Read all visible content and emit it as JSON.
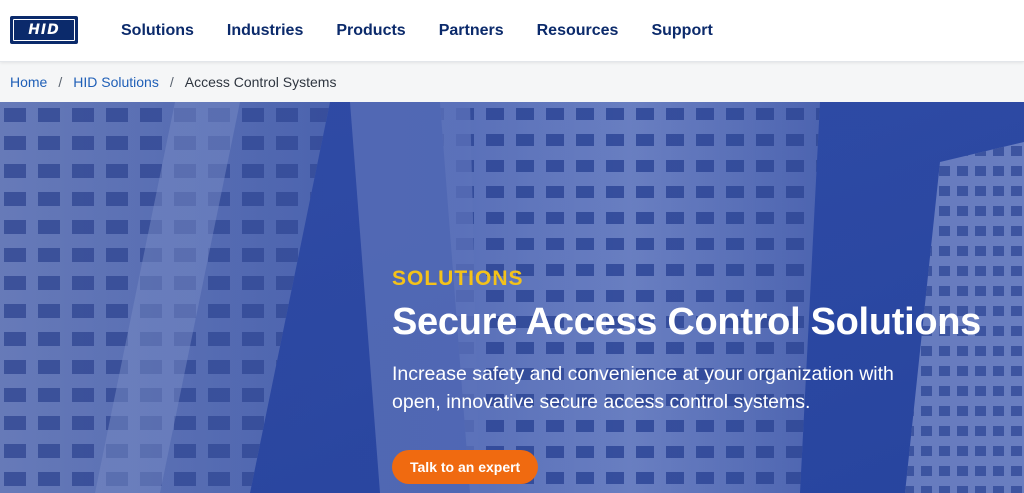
{
  "brand": {
    "logo_text": "HID",
    "color": "#0b2a6b"
  },
  "nav": {
    "items": [
      {
        "label": "Solutions"
      },
      {
        "label": "Industries"
      },
      {
        "label": "Products"
      },
      {
        "label": "Partners"
      },
      {
        "label": "Resources"
      },
      {
        "label": "Support"
      }
    ]
  },
  "breadcrumb": {
    "home": "Home",
    "parent": "HID Solutions",
    "current": "Access Control Systems",
    "separator": "/"
  },
  "hero": {
    "eyebrow": "SOLUTIONS",
    "title": "Secure Access Control Solutions",
    "description": "Increase safety and convenience at your organization with open, innovative secure access control systems.",
    "cta_label": "Talk to an expert"
  },
  "colors": {
    "accent": "#f06a10",
    "eyebrow": "#f4c21a",
    "hero_bg": "#2c4a9e",
    "link": "#1f5fb7"
  }
}
